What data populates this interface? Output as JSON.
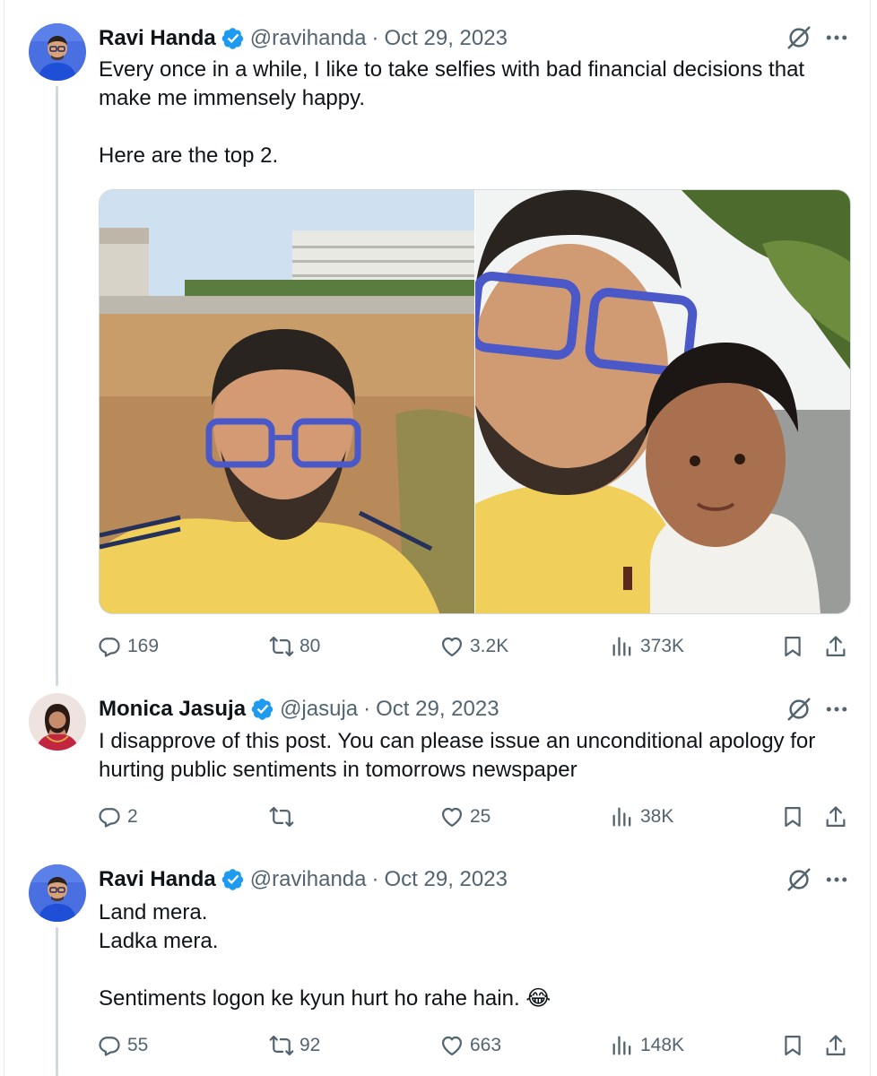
{
  "colors": {
    "text": "#0f1419",
    "secondary": "#536471",
    "verified": "#1d9bf0",
    "border": "#cfd9de"
  },
  "icons": {
    "reply": "reply-icon",
    "repost": "repost-icon",
    "like": "heart-icon",
    "views": "views-icon",
    "bookmark": "bookmark-icon",
    "share": "share-icon",
    "grok": "grok-icon",
    "more": "more-icon",
    "verified": "verified-badge-icon"
  },
  "tweets": [
    {
      "author": "Ravi Handa",
      "handle": "@ravihanda",
      "separator": "·",
      "date": "Oct 29, 2023",
      "text_lines": [
        "Every once in a while, I like to take selfies with bad financial decisions that",
        "make me immensely happy.",
        "",
        "Here are the top 2."
      ],
      "replies": "169",
      "reposts": "80",
      "likes": "3.2K",
      "views": "373K"
    },
    {
      "author": "Monica Jasuja",
      "handle": "@jasuja",
      "separator": "·",
      "date": "Oct 29, 2023",
      "text_lines": [
        "I disapprove of this post. You can please issue an unconditional apology for",
        "hurting public sentiments in tomorrows newspaper"
      ],
      "replies": "2",
      "reposts": "",
      "likes": "25",
      "views": "38K"
    },
    {
      "author": "Ravi Handa",
      "handle": "@ravihanda",
      "separator": "·",
      "date": "Oct 29, 2023",
      "text_lines": [
        "Land mera.",
        "Ladka mera.",
        "",
        "Sentiments logon ke kyun hurt ho rahe hain. 😂"
      ],
      "replies": "55",
      "reposts": "92",
      "likes": "663",
      "views": "148K"
    }
  ]
}
